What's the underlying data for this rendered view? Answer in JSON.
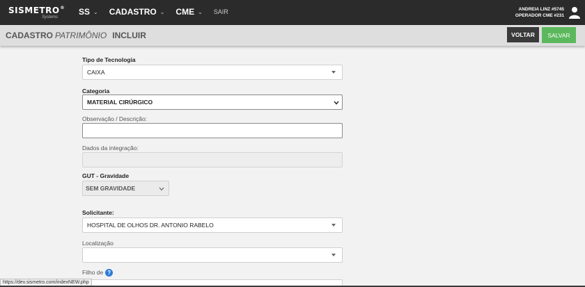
{
  "nav": {
    "logo": "SISMETRO",
    "logo_mark": "®",
    "logo_sub": "Systems",
    "items": [
      {
        "label": "SS",
        "chevron": "⌄"
      },
      {
        "label": "CADASTRO",
        "chevron": "⌄"
      },
      {
        "label": "CME",
        "chevron": "⌄"
      }
    ],
    "sair": "SAIR",
    "user_name": "ANDREIA LINZ #5745",
    "user_role": "OPERADOR CME #231"
  },
  "header": {
    "cadastro": "CADASTRO",
    "patrimonio": "PATRIMÔNIO",
    "incluir": "INCLUIR",
    "voltar": "VOLTAR",
    "salvar": "SALVAR"
  },
  "form": {
    "tipo_label": "Tipo de Tecnologia",
    "tipo_value": "CAIXA",
    "categoria_label": "Categoria",
    "categoria_value": "MATERIAL CIRÚRGICO",
    "observacao_label": "Observação / Descrição:",
    "observacao_value": "",
    "integracao_label": "Dados da integração:",
    "integracao_value": "",
    "gut_label": "GUT - Gravidade",
    "gut_value": "SEM GRAVIDADE",
    "solicitante_label": "Solicitante:",
    "solicitante_value": "HOSPITAL DE OLHOS DR. ANTONIO RABELO",
    "localizacao_label": "Localização",
    "localizacao_value": "",
    "filho_label": "Filho de",
    "help": "?"
  },
  "status_url": "https://dev.sismetro.com/indexNEW.php",
  "colors": {
    "topbar": "#2b2b2b",
    "salvar": "#5cb85c",
    "voltar": "#3a3a3a",
    "help": "#2a7bd6"
  }
}
